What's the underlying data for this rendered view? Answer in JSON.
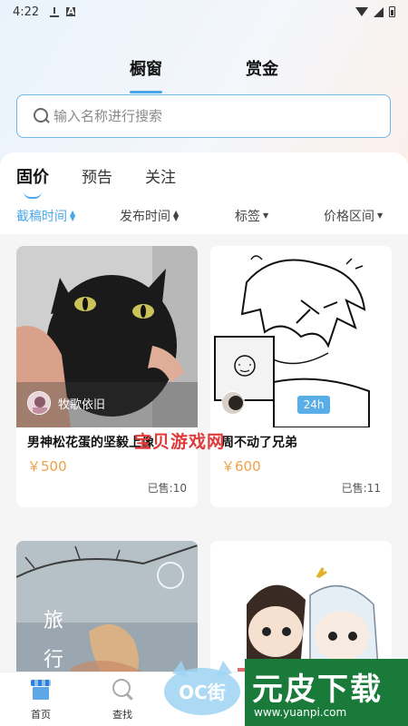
{
  "status": {
    "time": "4:22"
  },
  "top_tabs": [
    {
      "label": "橱窗",
      "active": true
    },
    {
      "label": "赏金",
      "active": false
    }
  ],
  "search": {
    "placeholder": "输入名称进行搜索"
  },
  "sub_tabs": [
    {
      "label": "固价",
      "active": true
    },
    {
      "label": "预告",
      "active": false
    },
    {
      "label": "关注",
      "active": false
    }
  ],
  "filters": [
    {
      "label": "截稿时间",
      "active": true
    },
    {
      "label": "发布时间",
      "active": false
    },
    {
      "label": "标签",
      "active": false
    },
    {
      "label": "价格区间",
      "active": false
    }
  ],
  "cards": [
    {
      "author": "牧歌依旧",
      "title": "男神松花蛋的坚毅上像",
      "price": "￥500",
      "sold": "已售:10"
    },
    {
      "author": "",
      "badge": "24h",
      "title": "周不动了兄弟",
      "price": "￥600",
      "sold": "已售:11"
    },
    {
      "vertical_text": "旅 行"
    },
    {}
  ],
  "watermark": "宝贝游戏网",
  "bottom_nav": [
    {
      "label": "首页"
    },
    {
      "label": "查找"
    }
  ],
  "overlay_logos": {
    "oc": "OC街",
    "yp_main": "元皮下载",
    "yp_url": "www.yuanpi.com"
  },
  "colors": {
    "accent": "#4aa7e8",
    "price": "#f0a048"
  }
}
